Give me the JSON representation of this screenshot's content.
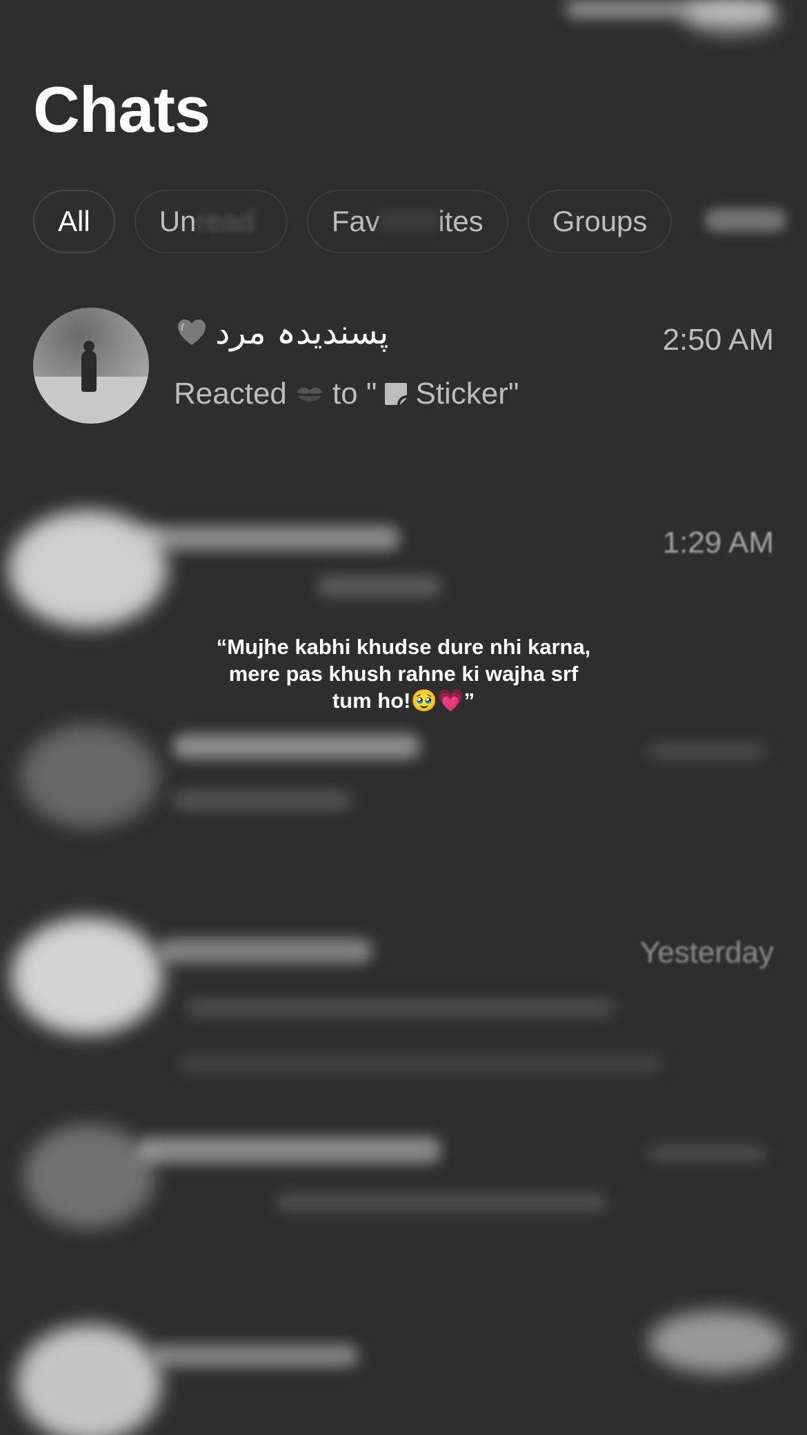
{
  "header": {
    "title": "Chats"
  },
  "filters": [
    {
      "label": "All",
      "active": true
    },
    {
      "label": "Un",
      "label_suffix": "read",
      "obscured": true
    },
    {
      "label": "Fav",
      "label_suffix": "ites",
      "obscured": true
    },
    {
      "label": "Groups"
    }
  ],
  "chats": [
    {
      "name": "پسندیدہ مرد",
      "name_icon": "grey-heart-icon",
      "time": "2:50 AM",
      "preview_prefix": "Reacted",
      "preview_reaction_icon": "kiss-mark-icon",
      "preview_mid": "to \"",
      "preview_sticker_icon": "sticker-icon",
      "preview_suffix": "Sticker\""
    },
    {
      "time": "1:29 AM",
      "obscured": true
    },
    {
      "time": "Yesterday",
      "obscured": true
    }
  ],
  "overlay": {
    "quote_line1": "“Mujhe kabhi khudse dure nhi karna,",
    "quote_line2": "mere pas khush rahne ki wajha srf",
    "quote_line3": "tum ho!🥹💗”"
  },
  "colors": {
    "background": "#2e2e2e",
    "text_primary": "#ffffff",
    "text_secondary": "#bdbdbd"
  }
}
